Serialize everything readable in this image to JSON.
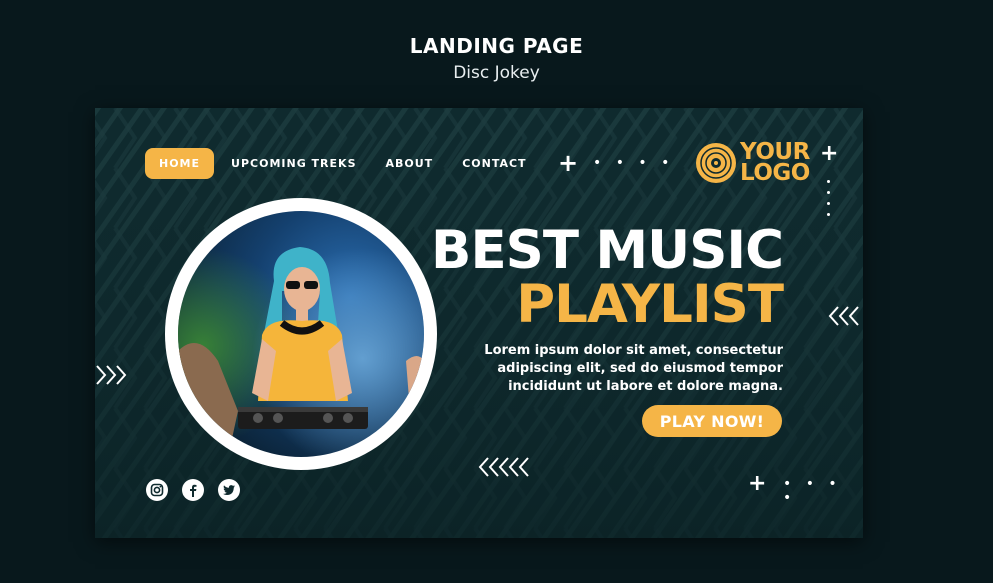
{
  "header": {
    "title": "LANDING PAGE",
    "subtitle": "Disc Jokey"
  },
  "nav": {
    "items": [
      {
        "label": "HOME",
        "active": true
      },
      {
        "label": "UPCOMING TREKS",
        "active": false
      },
      {
        "label": "ABOUT",
        "active": false
      },
      {
        "label": "CONTACT",
        "active": false
      }
    ]
  },
  "logo": {
    "line1": "YOUR",
    "line2": "LOGO",
    "icon": "vinyl-record-icon"
  },
  "hero": {
    "headline_line1": "BEST MUSIC",
    "headline_line2": "PLAYLIST",
    "body_line1": "Lorem ipsum dolor sit amet, consectetur",
    "body_line2": "adipiscing elit, sed do eiusmod tempor",
    "body_line3": "incididunt ut labore et dolore magna.",
    "cta_label": "PLAY NOW!",
    "photo_icon": "dj-photo"
  },
  "decor": {
    "plus": "+",
    "dots": "• • • •",
    "chevrons_right": "❯❯❯",
    "chevrons_left": "❮❮❮",
    "chevrons_left_5": "❮❮❮❮❮"
  },
  "social": [
    {
      "icon": "instagram-icon"
    },
    {
      "icon": "facebook-icon"
    },
    {
      "icon": "twitter-icon"
    }
  ],
  "colors": {
    "page_bg": "#08181c",
    "card_bg": "#0f2a2e",
    "accent": "#f5b547",
    "text": "#ffffff"
  }
}
